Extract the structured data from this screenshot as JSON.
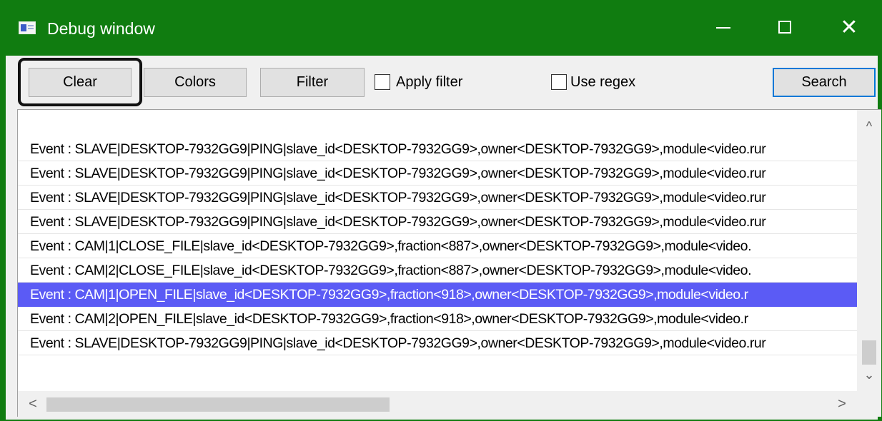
{
  "window": {
    "title": "Debug window",
    "accent_color": "#107c10",
    "icon": "debug-window-icon",
    "controls": {
      "minimize": "—",
      "maximize": "□",
      "close": "✕"
    }
  },
  "toolbar": {
    "clear_label": "Clear",
    "colors_label": "Colors",
    "filter_label": "Filter",
    "apply_filter_label": "Apply filter",
    "apply_filter_checked": false,
    "use_regex_label": "Use regex",
    "use_regex_checked": false,
    "search_label": "Search"
  },
  "log": {
    "selected_index": 6,
    "selection_color": "#5b5bf5",
    "rows": [
      "Event : SLAVE|DESKTOP-7932GG9|PING|slave_id<DESKTOP-7932GG9>,owner<DESKTOP-7932GG9>,module<video.rur",
      "Event : SLAVE|DESKTOP-7932GG9|PING|slave_id<DESKTOP-7932GG9>,owner<DESKTOP-7932GG9>,module<video.rur",
      "Event : SLAVE|DESKTOP-7932GG9|PING|slave_id<DESKTOP-7932GG9>,owner<DESKTOP-7932GG9>,module<video.rur",
      "Event : SLAVE|DESKTOP-7932GG9|PING|slave_id<DESKTOP-7932GG9>,owner<DESKTOP-7932GG9>,module<video.rur",
      "Event : CAM|1|CLOSE_FILE|slave_id<DESKTOP-7932GG9>,fraction<887>,owner<DESKTOP-7932GG9>,module<video.",
      "Event : CAM|2|CLOSE_FILE|slave_id<DESKTOP-7932GG9>,fraction<887>,owner<DESKTOP-7932GG9>,module<video.",
      "Event : CAM|1|OPEN_FILE|slave_id<DESKTOP-7932GG9>,fraction<918>,owner<DESKTOP-7932GG9>,module<video.r",
      "Event : CAM|2|OPEN_FILE|slave_id<DESKTOP-7932GG9>,fraction<918>,owner<DESKTOP-7932GG9>,module<video.r",
      "Event : SLAVE|DESKTOP-7932GG9|PING|slave_id<DESKTOP-7932GG9>,owner<DESKTOP-7932GG9>,module<video.rur"
    ]
  },
  "scrollbars": {
    "up_arrow": "^",
    "down_arrow": "⌄",
    "left_arrow": "<",
    "right_arrow": ">"
  }
}
